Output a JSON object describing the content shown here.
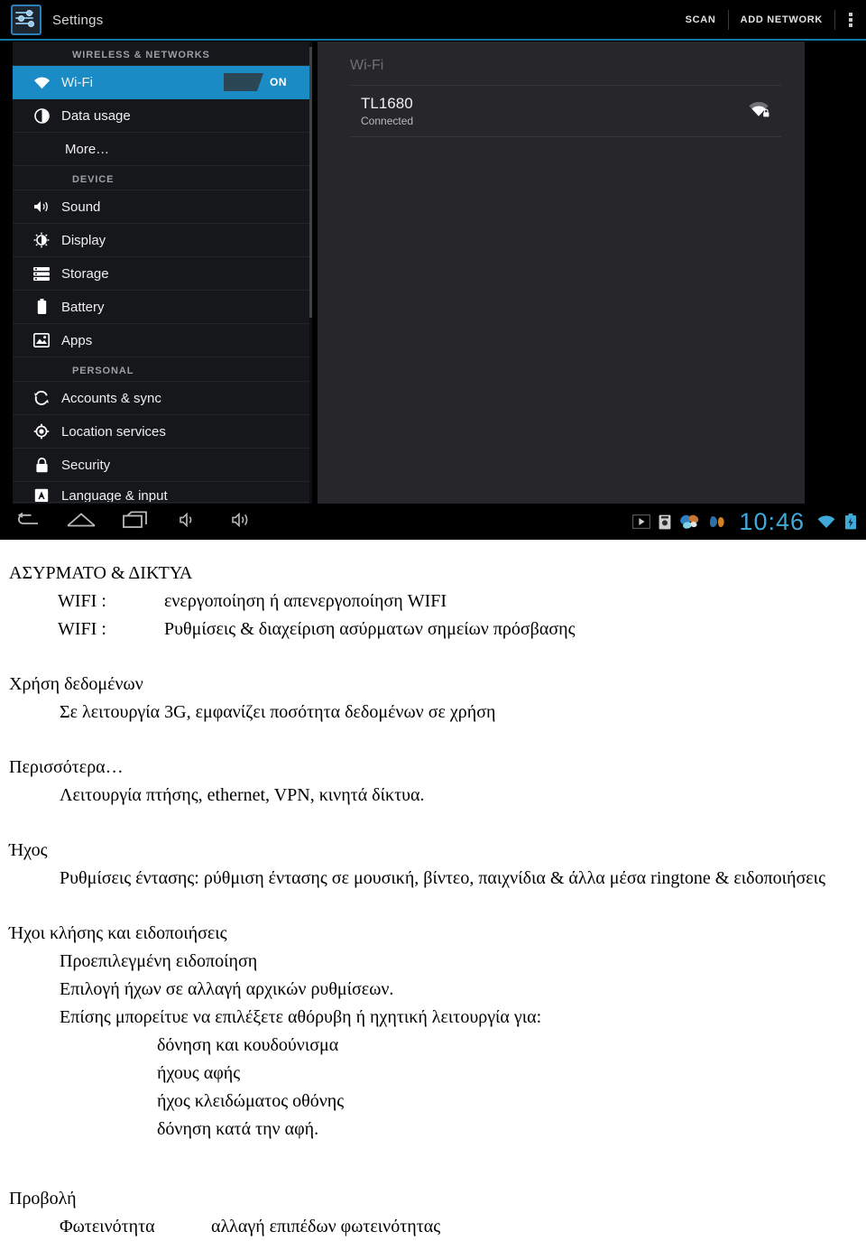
{
  "screenshot": {
    "actionbar": {
      "app_icon": "settings-sliders-icon",
      "title": "Settings",
      "scan_label": "SCAN",
      "add_network_label": "ADD NETWORK",
      "overflow_label": "more-options"
    },
    "sidebar": {
      "sections": [
        {
          "header": "WIRELESS & NETWORKS",
          "items": [
            {
              "label": "Wi-Fi",
              "icon": "wifi-icon",
              "selected": true,
              "toggle": {
                "state_label": "ON",
                "on": true
              }
            },
            {
              "label": "Data usage",
              "icon": "data-usage-icon",
              "selected": false
            },
            {
              "label": "More…",
              "icon": "none",
              "selected": false
            }
          ]
        },
        {
          "header": "DEVICE",
          "items": [
            {
              "label": "Sound",
              "icon": "speaker-icon",
              "selected": false
            },
            {
              "label": "Display",
              "icon": "brightness-icon",
              "selected": false
            },
            {
              "label": "Storage",
              "icon": "storage-icon",
              "selected": false
            },
            {
              "label": "Battery",
              "icon": "battery-icon",
              "selected": false
            },
            {
              "label": "Apps",
              "icon": "apps-image-icon",
              "selected": false
            }
          ]
        },
        {
          "header": "PERSONAL",
          "items": [
            {
              "label": "Accounts & sync",
              "icon": "sync-icon",
              "selected": false
            },
            {
              "label": "Location services",
              "icon": "location-icon",
              "selected": false
            },
            {
              "label": "Security",
              "icon": "lock-icon",
              "selected": false
            },
            {
              "label": "Language & input",
              "icon": "language-icon",
              "selected": false,
              "clipped": true
            }
          ]
        }
      ]
    },
    "content": {
      "title": "Wi-Fi",
      "network": {
        "ssid": "TL1680",
        "status": "Connected",
        "signal_icon": "wifi-secured-icon"
      }
    },
    "navbar": {
      "buttons": [
        {
          "name": "back-button",
          "icon": "back-arrow-icon"
        },
        {
          "name": "home-button",
          "icon": "home-icon"
        },
        {
          "name": "recents-button",
          "icon": "recents-icon"
        },
        {
          "name": "volume-down-button",
          "icon": "volume-down-icon"
        },
        {
          "name": "volume-up-button",
          "icon": "volume-up-icon"
        }
      ],
      "tray": {
        "play_icon": "play-icon",
        "screenshot_icon": "screenshot-icon",
        "app_icon_1": "butterfly-blue-icon",
        "app_icon_2": "butterfly-orange-icon",
        "clock": "10:46",
        "wifi_icon": "wifi-status-icon",
        "battery_icon": "battery-status-icon"
      }
    },
    "colors": {
      "accent_blue": "#1a8bc4",
      "header_rule": "#1277a8",
      "panel_bg": "#26262b",
      "sidebar_bg": "#15171a",
      "clock_blue": "#3fa9d8"
    }
  },
  "document": {
    "section_wireless": {
      "heading": "ΑΣΥΡΜΑΤΟ & ΔΙΚΤΥΑ",
      "row1_label": "WIFI :",
      "row1_text": "ενεργοποίηση ή απενεργοποίηση WIFI",
      "row2_label": "WIFI :",
      "row2_text": "Ρυθμίσεις & διαχείριση ασύρματων σημείων πρόσβασης"
    },
    "section_data": {
      "heading": "Χρήση δεδομένων",
      "line1": "Σε λειτουργία 3G, εμφανίζει ποσότητα δεδομένων σε χρήση"
    },
    "section_more": {
      "heading": "Περισσότερα…",
      "line1": "Λειτουργία πτήσης, ethernet, VPN, κινητά δίκτυα."
    },
    "section_sound": {
      "heading": "Ήχος",
      "paragraph": "Ρυθμίσεις έντασης: ρύθμιση έντασης σε μουσική, βίντεο, παιχνίδια & άλλα μέσα ringtone & ειδοποιήσεις",
      "sub_heading": "Ήχοι κλήσης και ειδοποιήσεις",
      "line1": "Προεπιλεγμένη ειδοποίηση",
      "line2": "Επιλογή ήχων σε αλλαγή αρχικών ρυθμίσεων.",
      "line3": "Επίσης μπορείτυε να επιλέξετε αθόρυβη ή ηχητική λειτουργία για:",
      "bullets": [
        "δόνηση και κουδούνισμα",
        "ήχους αφής",
        "ήχος κλειδώματος οθόνης",
        "δόνηση κατά την αφή."
      ]
    },
    "section_display": {
      "heading": "Προβολή",
      "row1_label": "Φωτεινότητα",
      "row1_text": "αλλαγή επιπέδων φωτεινότητας"
    }
  }
}
